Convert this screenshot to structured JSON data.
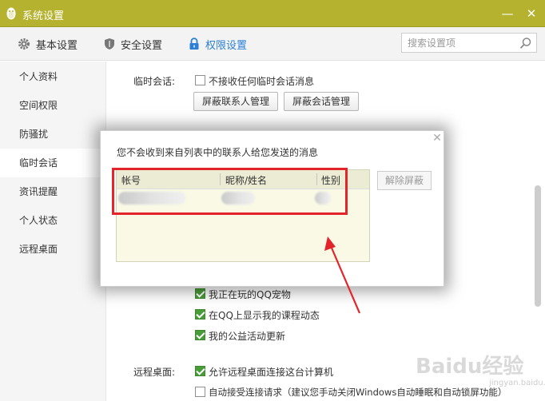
{
  "window": {
    "title": "系统设置",
    "minimize_icon": "minimize-icon",
    "close_icon": "close-icon"
  },
  "tabs": [
    {
      "label": "基本设置",
      "icon": "gear-icon"
    },
    {
      "label": "安全设置",
      "icon": "shield-icon"
    },
    {
      "label": "权限设置",
      "icon": "lock-icon",
      "active": true
    }
  ],
  "search": {
    "placeholder": "搜索设置项"
  },
  "sidebar": {
    "items": [
      {
        "label": "个人资料"
      },
      {
        "label": "空间权限"
      },
      {
        "label": "防骚扰"
      },
      {
        "label": "临时会话",
        "active": true
      },
      {
        "label": "资讯提醒"
      },
      {
        "label": "个人状态"
      },
      {
        "label": "远程桌面"
      }
    ]
  },
  "content": {
    "temp_chat_label": "临时会话:",
    "no_temp_chat": "不接收任何临时会话消息",
    "block_contacts_btn": "屏蔽联系人管理",
    "block_sessions_btn": "屏蔽会话管理",
    "status_items": [
      {
        "label": "我正在玩的QQ宠物",
        "checked": true
      },
      {
        "label": "在QQ上显示我的课程动态",
        "checked": true
      },
      {
        "label": "我的公益活动更新",
        "checked": true
      }
    ],
    "remote_label": "远程桌面:",
    "remote_items": [
      {
        "label": "允许远程桌面连接这台计算机",
        "checked": true
      },
      {
        "label": "自动接受连接请求（建议您手动关闭Windows自动睡眠和自动锁屏功能）",
        "checked": false
      }
    ]
  },
  "dialog": {
    "title": "您不会收到来自列表中的联系人给您发送的消息",
    "columns": [
      "帐号",
      "昵称/姓名",
      "性别"
    ],
    "unblock_btn": "解除屏蔽"
  },
  "watermark": {
    "text": "Baidu经验",
    "sub": "jingyan.baidu.com"
  },
  "colors": {
    "titlebar": "#b5b22f",
    "accent": "#2b7fd6",
    "highlight": "#e3242b",
    "checkbox": "#4a9c3a"
  }
}
